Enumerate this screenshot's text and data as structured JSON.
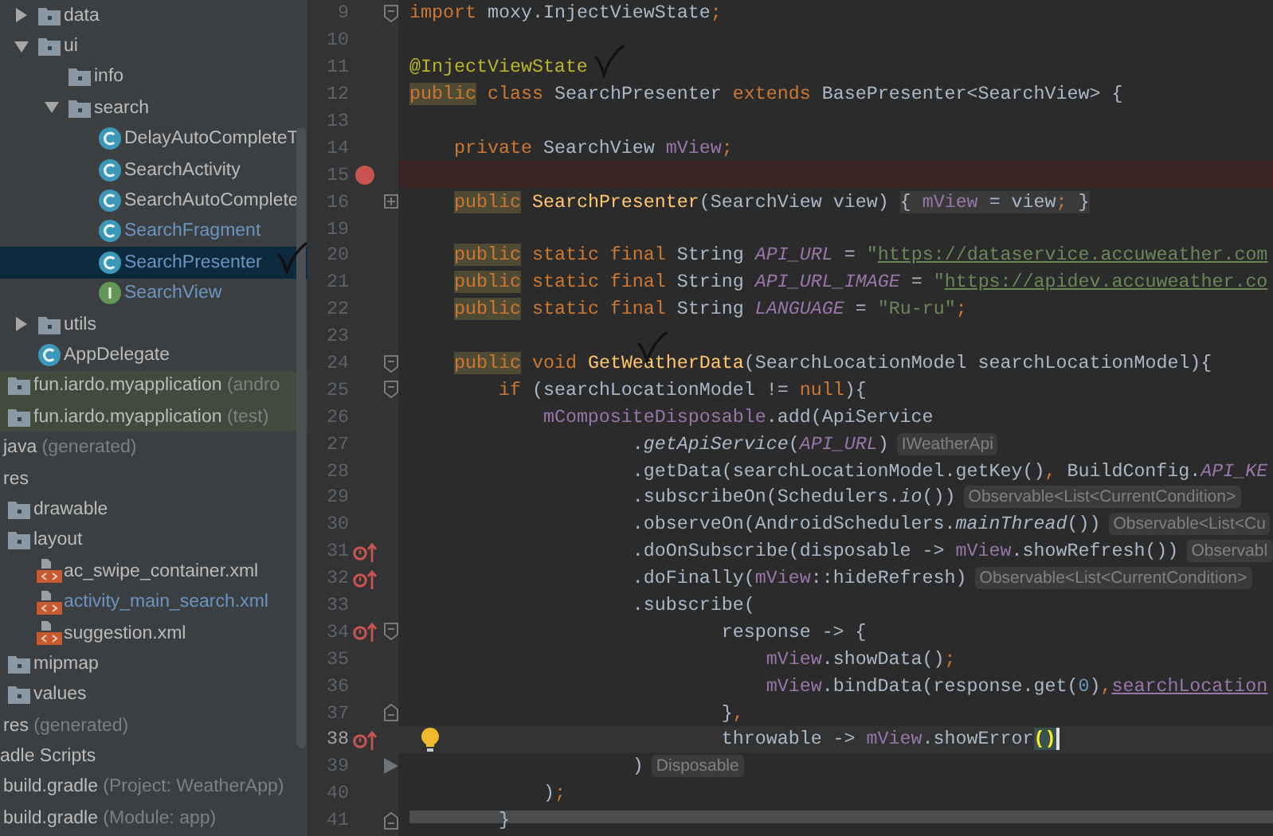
{
  "project_tree": {
    "items": [
      {
        "kind": "continuation",
        "children": [
          {
            "kind": "continuation",
            "children": [
              {
                "kind": "continuation",
                "children": [
                  {
                    "kind": "folder",
                    "label": "data",
                    "expanded": false,
                    "selected": false,
                    "modified": false
                  },
                  {
                    "kind": "folder",
                    "label": "ui",
                    "expanded": true,
                    "selected": false,
                    "modified": false,
                    "children": [
                      {
                        "kind": "folder",
                        "label": "info",
                        "selected": false,
                        "modified": false
                      },
                      {
                        "kind": "folder",
                        "label": "search",
                        "expanded": true,
                        "selected": false,
                        "modified": false,
                        "children": [
                          {
                            "kind": "class",
                            "label": "DelayAutoCompleteT",
                            "selected": false,
                            "modified": false
                          },
                          {
                            "kind": "class",
                            "label": "SearchActivity",
                            "selected": false,
                            "modified": false
                          },
                          {
                            "kind": "class",
                            "label": "SearchAutoComplete",
                            "selected": false,
                            "modified": false
                          },
                          {
                            "kind": "class",
                            "label": "SearchFragment",
                            "selected": false,
                            "modified": true
                          },
                          {
                            "kind": "class",
                            "label": "SearchPresenter",
                            "selected": true,
                            "modified": true,
                            "check_mark": true
                          },
                          {
                            "kind": "interface",
                            "label": "SearchView",
                            "selected": false,
                            "modified": true
                          }
                        ]
                      }
                    ]
                  },
                  {
                    "kind": "folder",
                    "label": "utils",
                    "expanded": false,
                    "selected": false,
                    "modified": false
                  },
                  {
                    "kind": "class",
                    "label": "AppDelegate",
                    "selected": false,
                    "modified": false
                  }
                ]
              },
              {
                "kind": "package",
                "label": "fun.iardo.myapplication",
                "note": "(andro",
                "selected": false,
                "modified": false
              },
              {
                "kind": "package",
                "label": "fun.iardo.myapplication",
                "note": "(test)",
                "selected": false,
                "modified": false
              }
            ]
          },
          {
            "kind": "plain",
            "label": "java",
            "note": "(generated)",
            "selected": false,
            "modified": false
          },
          {
            "kind": "plain",
            "label": "res",
            "selected": false,
            "modified": false,
            "children": [
              {
                "kind": "folder",
                "label": "drawable",
                "selected": false,
                "modified": false
              },
              {
                "kind": "folder",
                "label": "layout",
                "selected": false,
                "modified": false,
                "children": [
                  {
                    "kind": "layout-file",
                    "label": "ac_swipe_container.xml",
                    "selected": false,
                    "modified": false
                  },
                  {
                    "kind": "layout-file",
                    "label": "activity_main_search.xml",
                    "selected": false,
                    "modified": true
                  },
                  {
                    "kind": "layout-file",
                    "label": "suggestion.xml",
                    "selected": false,
                    "modified": false
                  }
                ]
              },
              {
                "kind": "folder",
                "label": "mipmap",
                "selected": false,
                "modified": false
              },
              {
                "kind": "folder",
                "label": "values",
                "selected": false,
                "modified": false
              }
            ]
          },
          {
            "kind": "plain",
            "label": "res",
            "note": "(generated)",
            "selected": false,
            "modified": false
          }
        ]
      },
      {
        "kind": "plain",
        "label": "adle Scripts",
        "selected": false,
        "modified": false,
        "children": [
          {
            "kind": "plain",
            "label": "build.gradle",
            "note": "(Project: WeatherApp)",
            "selected": false,
            "modified": false
          },
          {
            "kind": "plain",
            "label": "build.gradle",
            "note": "(Module: app)",
            "selected": false,
            "modified": false
          }
        ]
      }
    ]
  },
  "editor": {
    "lines": [
      {
        "number": "9",
        "fold_start": true,
        "code": [
          {
            "kind": "keyword",
            "text": "import"
          },
          {
            "kind": "plain",
            "text": " moxy.InjectViewState"
          },
          {
            "kind": "keyword",
            "text": ";"
          }
        ]
      },
      {
        "number": "10"
      },
      {
        "number": "11",
        "code": [
          {
            "kind": "annotation",
            "text": "@InjectViewState",
            "check_mark_after": true
          }
        ]
      },
      {
        "number": "12",
        "code": [
          {
            "kind": "keyword-marked",
            "text": "public"
          },
          {
            "kind": "keyword",
            "text": " class"
          },
          {
            "kind": "plain",
            "text": " SearchPresenter "
          },
          {
            "kind": "keyword",
            "text": "extends"
          },
          {
            "kind": "plain",
            "text": " BasePresenter<SearchView> {"
          }
        ]
      },
      {
        "number": "13"
      },
      {
        "number": "14",
        "code": [
          {
            "kind": "keyword",
            "text": "    private"
          },
          {
            "kind": "plain",
            "text": " SearchView "
          },
          {
            "kind": "field",
            "text": "mView"
          },
          {
            "kind": "keyword",
            "text": ";"
          }
        ]
      },
      {
        "number": "15",
        "breakpoint": true
      },
      {
        "number": "16",
        "fold_collapsed": true,
        "code": [
          {
            "kind": "keyword-marked",
            "text": "    public"
          },
          {
            "kind": "declaration",
            "text": " SearchPresenter"
          },
          {
            "kind": "plain",
            "text": "(SearchView view)"
          }
        ],
        "folded_code": [
          {
            "kind": "plain",
            "text": "{ "
          },
          {
            "kind": "field",
            "text": "mView"
          },
          {
            "kind": "plain",
            "text": " = view"
          },
          {
            "kind": "keyword",
            "text": ";"
          },
          {
            "kind": "plain",
            "text": " }"
          }
        ]
      },
      {
        "number": "19"
      },
      {
        "number": "20",
        "code": [
          {
            "kind": "keyword-marked",
            "text": "    public"
          },
          {
            "kind": "keyword",
            "text": " static final"
          },
          {
            "kind": "plain",
            "text": " String "
          },
          {
            "kind": "constant",
            "text": "API_URL"
          },
          {
            "kind": "plain",
            "text": " = "
          },
          {
            "kind": "string",
            "text": "\""
          },
          {
            "kind": "link",
            "text": "https://dataservice.accuweather.com"
          }
        ]
      },
      {
        "number": "21",
        "code": [
          {
            "kind": "keyword-marked",
            "text": "    public"
          },
          {
            "kind": "keyword",
            "text": " static final"
          },
          {
            "kind": "plain",
            "text": " String "
          },
          {
            "kind": "constant",
            "text": "API_URL_IMAGE"
          },
          {
            "kind": "plain",
            "text": " = "
          },
          {
            "kind": "string",
            "text": "\""
          },
          {
            "kind": "link",
            "text": "https://apidev.accuweather.co"
          }
        ]
      },
      {
        "number": "22",
        "code": [
          {
            "kind": "keyword-marked",
            "text": "    public"
          },
          {
            "kind": "keyword",
            "text": " static final"
          },
          {
            "kind": "plain",
            "text": " String "
          },
          {
            "kind": "constant",
            "text": "LANGUAGE"
          },
          {
            "kind": "plain",
            "text": " = "
          },
          {
            "kind": "string",
            "text": "\"Ru-ru\""
          },
          {
            "kind": "keyword",
            "text": ";"
          }
        ]
      },
      {
        "number": "23"
      },
      {
        "number": "24",
        "fold_start": true,
        "code": [
          {
            "kind": "keyword-marked",
            "text": "    public"
          },
          {
            "kind": "keyword",
            "text": " void"
          },
          {
            "kind": "declaration",
            "text": " GetWeatherData",
            "check_mark_above": true
          },
          {
            "kind": "plain",
            "text": "(SearchLocationModel searchLocationModel){"
          }
        ]
      },
      {
        "number": "25",
        "fold_start": true,
        "code": [
          {
            "kind": "keyword",
            "text": "        if"
          },
          {
            "kind": "plain",
            "text": " (searchLocationModel != "
          },
          {
            "kind": "keyword",
            "text": "null"
          },
          {
            "kind": "plain",
            "text": "){"
          }
        ]
      },
      {
        "number": "26",
        "code": [
          {
            "kind": "field",
            "text": "            mCompositeDisposable"
          },
          {
            "kind": "plain",
            "text": ".add(ApiService"
          }
        ]
      },
      {
        "number": "27",
        "hint": "IWeatherApi",
        "code": [
          {
            "kind": "plain",
            "text": "                    ."
          },
          {
            "kind": "italic",
            "text": "getApiService"
          },
          {
            "kind": "plain",
            "text": "("
          },
          {
            "kind": "constant",
            "text": "API_URL"
          },
          {
            "kind": "plain",
            "text": ")"
          }
        ]
      },
      {
        "number": "28",
        "code": [
          {
            "kind": "plain",
            "text": "                    .getData(searchLocationModel.getKey()"
          },
          {
            "kind": "keyword",
            "text": ","
          },
          {
            "kind": "plain",
            "text": " BuildConfig."
          },
          {
            "kind": "constant",
            "text": "API_KE"
          }
        ]
      },
      {
        "number": "29",
        "hint": "Observable<List<CurrentCondition>",
        "code": [
          {
            "kind": "plain",
            "text": "                    .subscribeOn(Schedulers."
          },
          {
            "kind": "italic",
            "text": "io"
          },
          {
            "kind": "plain",
            "text": "())"
          }
        ]
      },
      {
        "number": "30",
        "hint": "Observable<List<Cu",
        "code": [
          {
            "kind": "plain",
            "text": "                    .observeOn(AndroidSchedulers."
          },
          {
            "kind": "italic",
            "text": "mainThread"
          },
          {
            "kind": "plain",
            "text": "())"
          }
        ]
      },
      {
        "number": "31",
        "override": true,
        "hint": "Observabl",
        "code": [
          {
            "kind": "plain",
            "text": "                    .doOnSubscribe(disposable -> "
          },
          {
            "kind": "field",
            "text": "mView"
          },
          {
            "kind": "plain",
            "text": ".showRefresh())"
          }
        ]
      },
      {
        "number": "32",
        "override": true,
        "hint": "Observable<List<CurrentCondition>",
        "code": [
          {
            "kind": "plain",
            "text": "                    .doFinally("
          },
          {
            "kind": "field",
            "text": "mView"
          },
          {
            "kind": "plain",
            "text": "::hideRefresh)"
          }
        ]
      },
      {
        "number": "33",
        "code": [
          {
            "kind": "plain",
            "text": "                    .subscribe("
          }
        ]
      },
      {
        "number": "34",
        "override": true,
        "fold_start": true,
        "code": [
          {
            "kind": "plain",
            "text": "                            response -> {"
          }
        ]
      },
      {
        "number": "35",
        "code": [
          {
            "kind": "field",
            "text": "                                mView"
          },
          {
            "kind": "plain",
            "text": ".showData()"
          },
          {
            "kind": "keyword",
            "text": ";"
          }
        ]
      },
      {
        "number": "36",
        "code": [
          {
            "kind": "field",
            "text": "                                mView"
          },
          {
            "kind": "plain",
            "text": ".bindData(response.get("
          },
          {
            "kind": "number",
            "text": "0"
          },
          {
            "kind": "plain",
            "text": ")"
          },
          {
            "kind": "keyword",
            "text": ","
          },
          {
            "kind": "field-underlined",
            "text": "searchLocation"
          }
        ]
      },
      {
        "number": "37",
        "fold_end": true,
        "code": [
          {
            "kind": "plain",
            "text": "                            }"
          },
          {
            "kind": "keyword",
            "text": ","
          }
        ]
      },
      {
        "number": "38",
        "override": true,
        "current": true,
        "bulb": true,
        "caret": true,
        "code": [
          {
            "kind": "plain",
            "text": "                            throwable -> "
          },
          {
            "kind": "field",
            "text": "mView"
          },
          {
            "kind": "plain",
            "text": ".showError"
          },
          {
            "kind": "bracket-match",
            "text": "()"
          }
        ]
      },
      {
        "number": "39",
        "fold_arrow": true,
        "hint": "Disposable",
        "code": [
          {
            "kind": "plain",
            "text": "                    )"
          }
        ]
      },
      {
        "number": "40",
        "code": [
          {
            "kind": "plain",
            "text": "            )"
          },
          {
            "kind": "keyword",
            "text": ";"
          }
        ]
      },
      {
        "number": "41",
        "fold_end": true,
        "code": [
          {
            "kind": "plain",
            "text": "        }"
          }
        ]
      }
    ]
  }
}
